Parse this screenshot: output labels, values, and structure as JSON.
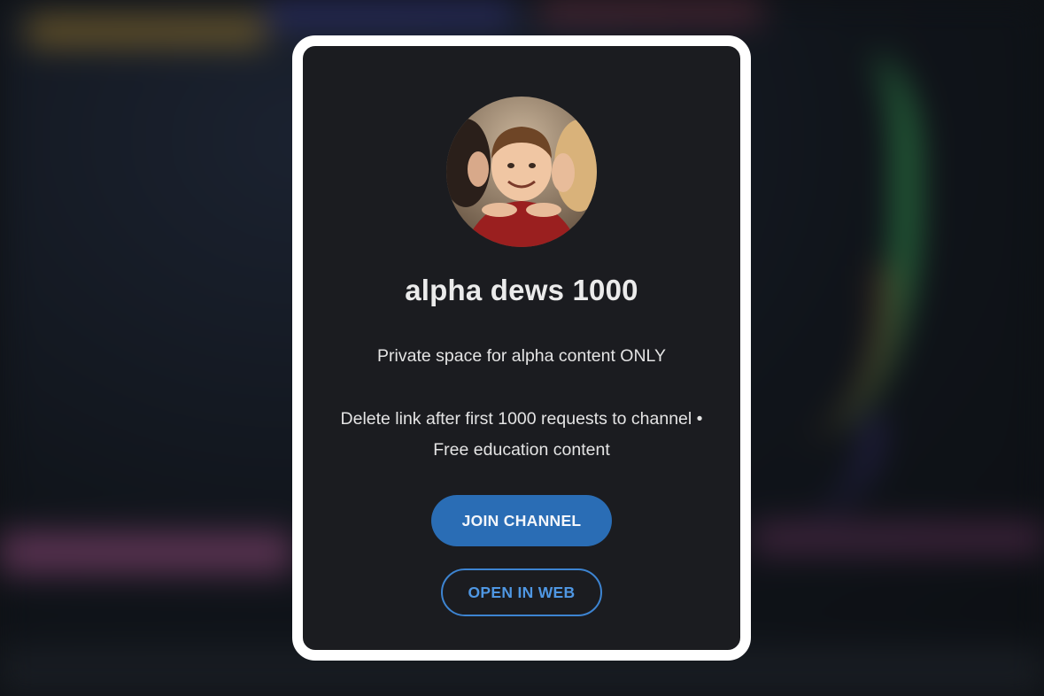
{
  "channel": {
    "name": "alpha dews 1000",
    "avatar_icon": "channel-avatar-photo",
    "description_line1": "Private space for alpha content ONLY",
    "description_line2": "Delete link after first 1000 requests to channel •",
    "description_line3": "Free education content"
  },
  "actions": {
    "join_label": "JOIN CHANNEL",
    "open_web_label": "OPEN IN WEB"
  },
  "colors": {
    "modal_bg": "#1b1c20",
    "modal_border": "#ffffff",
    "join_bg": "#2a6db5",
    "web_outline": "#3d84d1"
  }
}
